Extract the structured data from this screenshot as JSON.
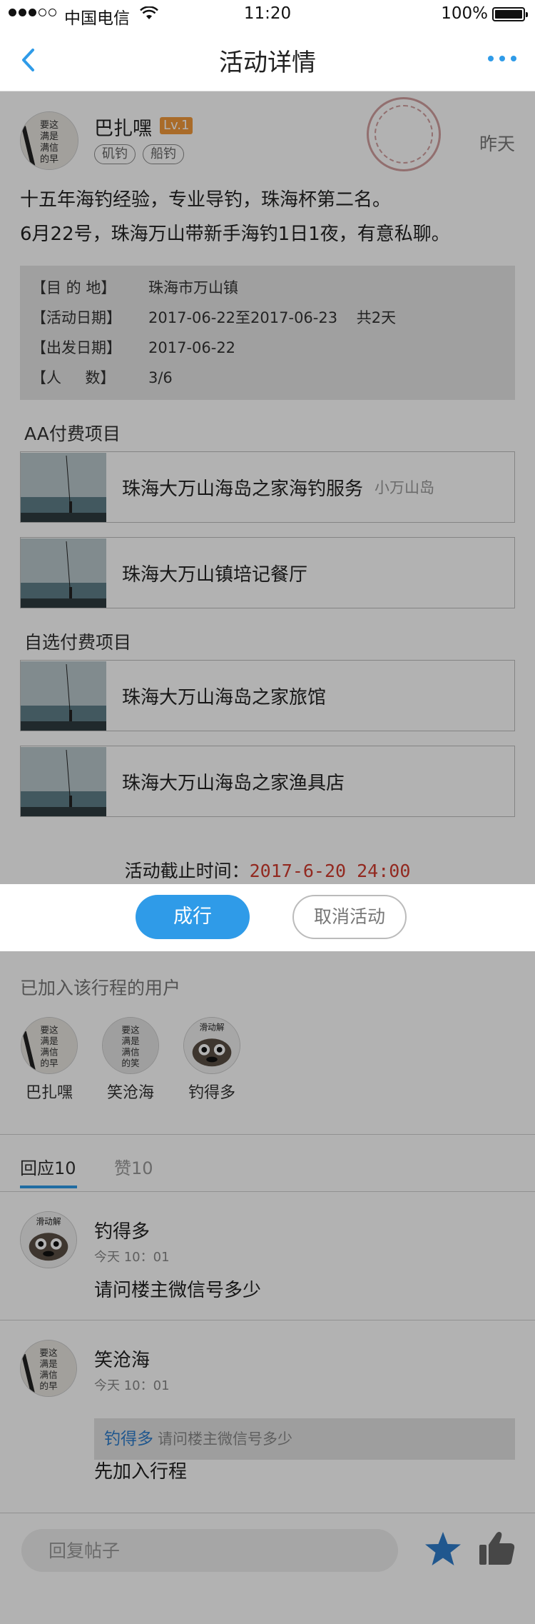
{
  "status_bar": {
    "carrier": "中国电信",
    "time": "11:20",
    "battery": "100%"
  },
  "nav": {
    "title": "活动详情"
  },
  "post": {
    "author": "巴扎嘿",
    "level": "Lv.1",
    "tags": [
      "矶钓",
      "船钓"
    ],
    "time": "昨天",
    "text_line1": "十五年海钓经验，专业导钓，珠海杯第二名。",
    "text_line2": "6月22号，珠海万山带新手海钓1日1夜，有意私聊。"
  },
  "info": {
    "destination_label": "【目 的 地】",
    "destination_value": "珠海市万山镇",
    "activity_date_label": "【活动日期】",
    "activity_date_value": "2017-06-22至2017-06-23    共2天",
    "depart_date_label": "【出发日期】",
    "depart_date_value": "2017-06-22",
    "people_label": "【人     数】",
    "people_value": "3/6"
  },
  "aa_section": {
    "title": "AA付费项目",
    "items": [
      {
        "name": "珠海大万山海岛之家海钓服务",
        "sub": "小万山岛"
      },
      {
        "name": "珠海大万山镇培记餐厅",
        "sub": ""
      }
    ]
  },
  "optional_section": {
    "title": "自选付费项目",
    "items": [
      {
        "name": "珠海大万山海岛之家旅馆"
      },
      {
        "name": "珠海大万山海岛之家渔具店"
      }
    ]
  },
  "deadline": {
    "label": "活动截止时间：",
    "value": "2017-6-20 24:00"
  },
  "actions": {
    "confirm": "成行",
    "cancel": "取消活动"
  },
  "joined": {
    "title": "已加入该行程的用户",
    "users": [
      "巴扎嘿",
      "笑沧海",
      "钓得多"
    ]
  },
  "tabs": {
    "replies": "回应10",
    "likes": "赞10"
  },
  "replies": [
    {
      "name": "钓得多",
      "time": "今天 10：01",
      "text": "请问楼主微信号多少"
    },
    {
      "name": "笑沧海",
      "time": "今天 10：01",
      "quote_name": "钓得多",
      "quote_text": "请问楼主微信号多少",
      "text": "先加入行程"
    }
  ],
  "footer": {
    "reply_placeholder": "回复帖子"
  },
  "colors": {
    "accent": "#2f9be8",
    "level_badge": "#f39a3b",
    "deadline": "#d23b2e"
  },
  "icons": {
    "back": "chevron-left-icon",
    "more": "more-dots-icon",
    "star": "star-icon",
    "like": "thumbs-up-icon"
  }
}
